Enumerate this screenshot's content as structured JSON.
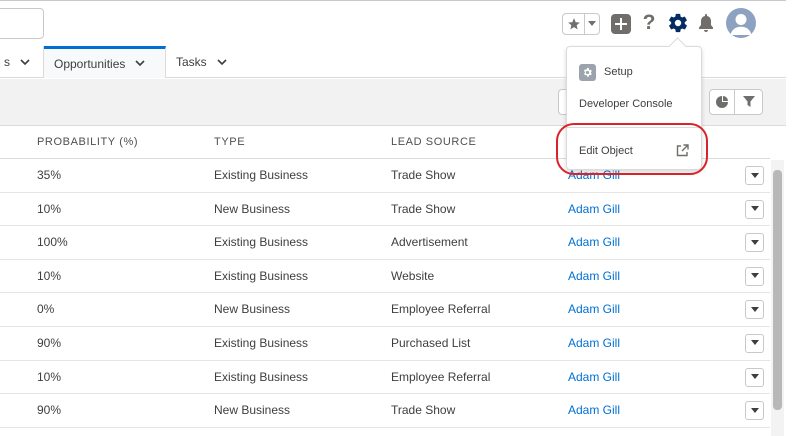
{
  "nav": {
    "tabs": [
      {
        "label": "s"
      },
      {
        "label": "Opportunities",
        "active": true
      },
      {
        "label": "Tasks"
      }
    ]
  },
  "header": {
    "icons": [
      "star-icon",
      "plus-icon",
      "help-icon",
      "gear-icon",
      "bell-icon",
      "avatar-icon"
    ],
    "help_label": "?"
  },
  "dropdown": {
    "setup": "Setup",
    "developer_console": "Developer Console",
    "edit_object": "Edit Object"
  },
  "table": {
    "columns": [
      "PROBABILITY (%)",
      "TYPE",
      "LEAD SOURCE"
    ],
    "rows": [
      {
        "probability": "35%",
        "type": "Existing Business",
        "lead_source": "Trade Show",
        "owner": "Adam Gill"
      },
      {
        "probability": "10%",
        "type": "New Business",
        "lead_source": "Trade Show",
        "owner": "Adam Gill"
      },
      {
        "probability": "100%",
        "type": "Existing Business",
        "lead_source": "Advertisement",
        "owner": "Adam Gill"
      },
      {
        "probability": "10%",
        "type": "Existing Business",
        "lead_source": "Website",
        "owner": "Adam Gill"
      },
      {
        "probability": "0%",
        "type": "New Business",
        "lead_source": "Employee Referral",
        "owner": "Adam Gill"
      },
      {
        "probability": "90%",
        "type": "Existing Business",
        "lead_source": "Purchased List",
        "owner": "Adam Gill"
      },
      {
        "probability": "10%",
        "type": "Existing Business",
        "lead_source": "Employee Referral",
        "owner": "Adam Gill"
      },
      {
        "probability": "90%",
        "type": "New Business",
        "lead_source": "Trade Show",
        "owner": "Adam Gill"
      }
    ]
  },
  "colors": {
    "accent": "#0070d2",
    "highlight": "#d8232a",
    "link": "#0070d2"
  }
}
